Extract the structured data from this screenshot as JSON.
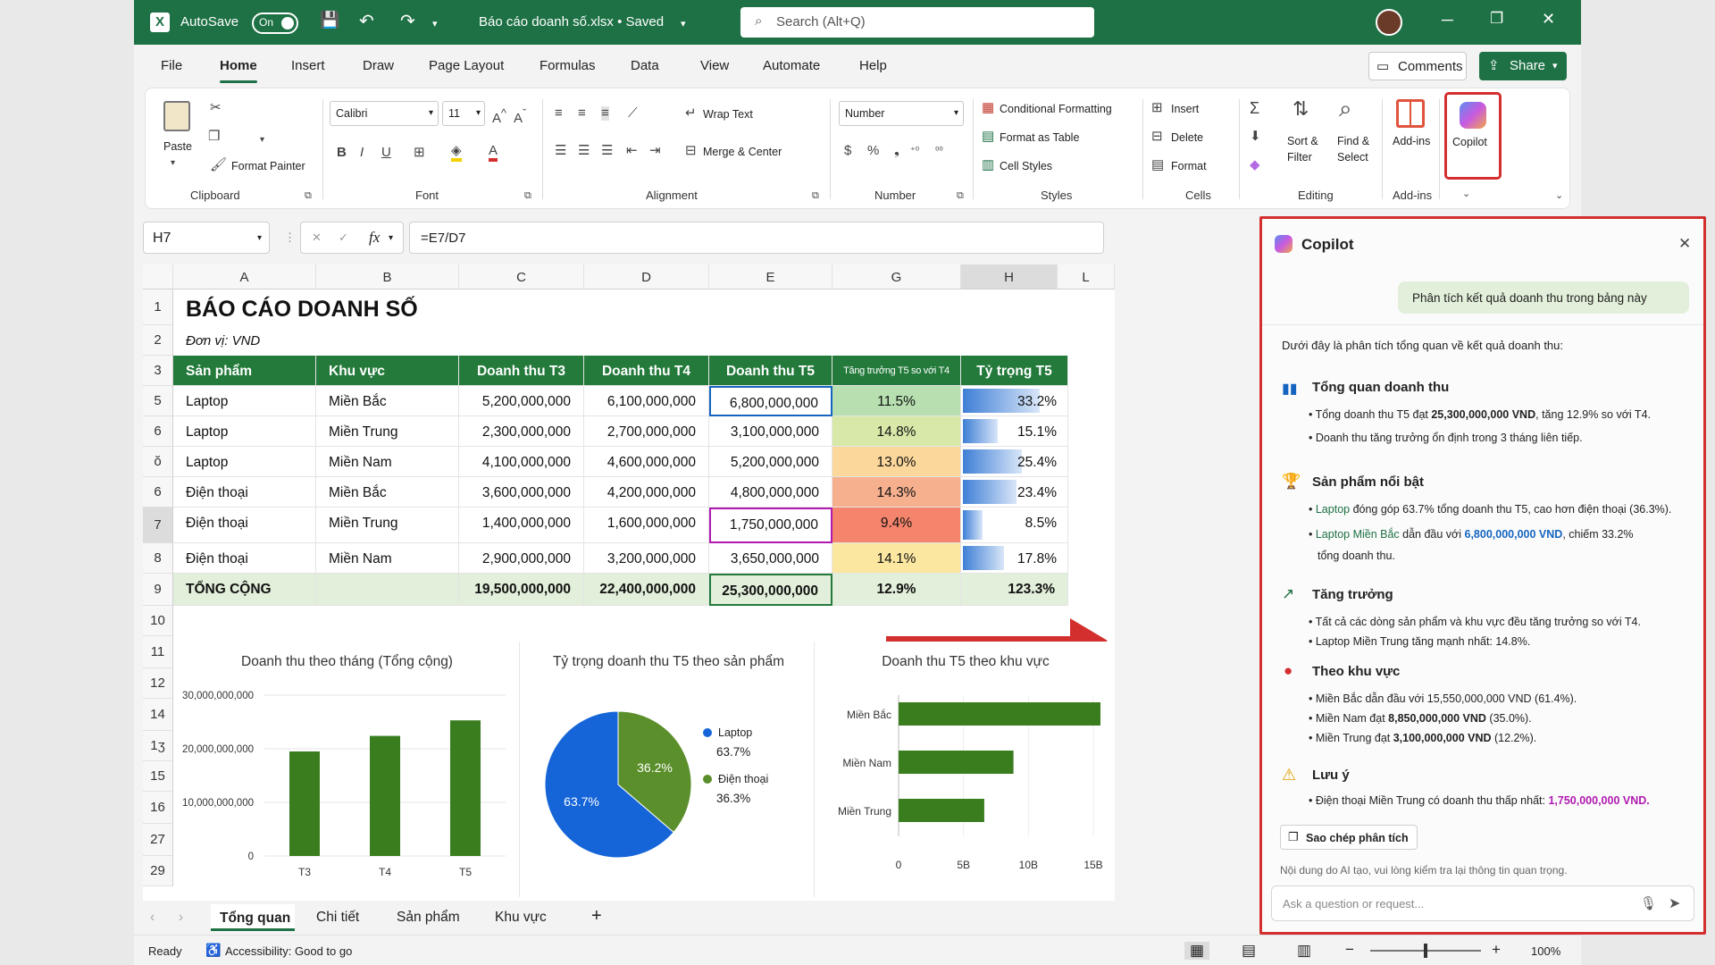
{
  "titlebar": {
    "autosave": "AutoSave",
    "toggle": "On",
    "filename": "Báo cáo doanh số.xlsx • Saved",
    "search_placeholder": "Search (Alt+Q)"
  },
  "menu": {
    "tabs": [
      "File",
      "Home",
      "Insert",
      "Draw",
      "Page Layout",
      "Formulas",
      "Data",
      "View",
      "Automate",
      "Help"
    ],
    "comments": "Comments",
    "share": "Share"
  },
  "ribbon": {
    "clipboard": {
      "paste": "Paste",
      "format_painter": "Format Painter",
      "label": "Clipboard"
    },
    "font": {
      "name": "Calibri",
      "size": "11",
      "label": "Font"
    },
    "alignment": {
      "wrap": "Wrap Text",
      "merge": "Merge & Center",
      "label": "Alignment"
    },
    "number": {
      "format": "Number",
      "label": "Number"
    },
    "styles": {
      "cond": "Conditional Formatting",
      "table": "Format as Table",
      "cell": "Cell Styles",
      "label": "Styles"
    },
    "cells": {
      "insert": "Insert",
      "delete": "Delete",
      "format": "Format",
      "label": "Cells"
    },
    "editing": {
      "sort1": "Sort &",
      "sort2": "Filter",
      "find1": "Find &",
      "find2": "Select",
      "label": "Editing"
    },
    "addins": {
      "addins": "Add-ins",
      "label": "Add-ins"
    },
    "copilot": {
      "label": "Copilot"
    }
  },
  "formula_bar": {
    "cell_ref": "H7",
    "formula": "=E7/D7"
  },
  "sheet": {
    "columns": [
      "A",
      "B",
      "C",
      "D",
      "E",
      "G",
      "H",
      "L"
    ],
    "row_numbers": [
      "1",
      "2",
      "3",
      "5",
      "6",
      "ŏ",
      "6",
      "7",
      "8",
      "9",
      "10",
      "11",
      "12",
      "14",
      "1ʒ",
      "15",
      "16",
      "27",
      "29"
    ],
    "title": "BÁO CÁO DOANH SỐ",
    "unit": "Đơn vị: VND",
    "headers": [
      "Sản phẩm",
      "Khu vực",
      "Doanh thu T3",
      "Doanh thu T4",
      "Doanh thu T5",
      "Tăng trưởng T5 so với T4",
      "Tỷ trọng T5"
    ],
    "rows": [
      {
        "product": "Laptop",
        "region": "Miền Bắc",
        "t3": "5,200,000,000",
        "t4": "6,100,000,000",
        "t5": "6,800,000,000",
        "growth": "11.5%",
        "share": "33.2%",
        "share_val": 33.2,
        "gcolor": "#b7dfb0"
      },
      {
        "product": "Laptop",
        "region": "Miền Trung",
        "t3": "2,300,000,000",
        "t4": "2,700,000,000",
        "t5": "3,100,000,000",
        "growth": "14.8%",
        "share": "15.1%",
        "share_val": 15.1,
        "gcolor": "#d7e8a8"
      },
      {
        "product": "Laptop",
        "region": "Miền Nam",
        "t3": "4,100,000,000",
        "t4": "4,600,000,000",
        "t5": "5,200,000,000",
        "growth": "13.0%",
        "share": "25.4%",
        "share_val": 25.4,
        "gcolor": "#fcd79b"
      },
      {
        "product": "Điện thoại",
        "region": "Miền Bắc",
        "t3": "3,600,000,000",
        "t4": "4,200,000,000",
        "t5": "4,800,000,000",
        "growth": "14.3%",
        "share": "23.4%",
        "share_val": 23.4,
        "gcolor": "#f7b08e"
      },
      {
        "product": "Điện thoại",
        "region": "Miền Trung",
        "t3": "1,400,000,000",
        "t4": "1,600,000,000",
        "t5": "1,750,000,000",
        "growth": "9.4%",
        "share": "8.5%",
        "share_val": 8.5,
        "gcolor": "#f4846b"
      },
      {
        "product": "Điện thoại",
        "region": "Miền Nam",
        "t3": "2,900,000,000",
        "t4": "3,200,000,000",
        "t5": "3,650,000,000",
        "growth": "14.1%",
        "share": "17.8%",
        "share_val": 17.8,
        "gcolor": "#fbe7a0"
      }
    ],
    "total": {
      "label": "TỔNG CỘNG",
      "t3": "19,500,000,000",
      "t4": "22,400,000,000",
      "t5": "25,300,000,000",
      "growth": "12.9%",
      "share": "123.3%"
    }
  },
  "colors": {
    "excel_green": "#1e7145",
    "header_green": "#237a3b",
    "chart_green": "#3a7d1f",
    "pie_blue": "#1565d8",
    "pie_green": "#5b8f2b",
    "copilot_border": "#d32f2f",
    "accent_blue": "#1565c0",
    "accent_purple": "#b01ab0"
  },
  "chart_data": [
    {
      "type": "bar",
      "title": "Doanh thu theo tháng (Tổng cộng)",
      "categories": [
        "T3",
        "T4",
        "T5"
      ],
      "values": [
        19500000000,
        22400000000,
        25300000000
      ],
      "ylim": [
        0,
        30000000000
      ],
      "yticks": [
        "30,000,000,000",
        "20,000,000,000",
        "10,000,000,000",
        "0"
      ]
    },
    {
      "type": "pie",
      "title": "Tỷ trọng doanh thu T5 theo sản phẩm",
      "slices": [
        {
          "name": "Laptop",
          "value": 63.7,
          "label": "63.7%"
        },
        {
          "name": "Điện thoại",
          "value": 36.3,
          "label": "36.3%"
        }
      ],
      "inner_labels": [
        "63.7%",
        "36.2%"
      ]
    },
    {
      "type": "bar",
      "orientation": "horizontal",
      "title": "Doanh thu T5 theo khu vực",
      "categories": [
        "Miền Bắc",
        "Miền Nam",
        "Miền Trung"
      ],
      "values": [
        15550000000,
        8850000000,
        6600000000
      ],
      "xlim": [
        0,
        15000000000
      ],
      "xticks": [
        "0",
        "5B",
        "10B",
        "15B"
      ]
    }
  ],
  "copilot": {
    "title": "Copilot",
    "user_msg": "Phân tích kết quả doanh thu trong bảng này",
    "intro": "Dưới đây là phân tích tổng quan về kết quả doanh thu:",
    "s1_title": "Tổng quan doanh thu",
    "s1_b1_a": "Tổng doanh thu T5 đạt ",
    "s1_b1_b": "25,300,000,000 VND",
    "s1_b1_c": ", tăng 12.9% so với T4.",
    "s1_b2": "Doanh thu tăng trưởng ổn định trong 3 tháng liên tiếp.",
    "s2_title": "Sản phẩm nổi bật",
    "s2_b1_a": "Laptop",
    "s2_b1_b": " đóng góp 63.7% tổng doanh thu T5, cao hơn điện thoại (36.3%).",
    "s2_b2_a": "Laptop Miền Bắc",
    "s2_b2_b": " dẫn đầu với ",
    "s2_b2_c": "6,800,000,000 VND",
    "s2_b2_d": ", chiếm 33.2%",
    "s2_b2_e": "tổng doanh thu.",
    "s3_title": "Tăng trưởng",
    "s3_b1": "Tất cả các dòng sản phẩm và khu vực đều tăng trưởng so với T4.",
    "s3_b2": "Laptop Miền Trung tăng mạnh nhất: 14.8%.",
    "s4_title": "Theo khu vực",
    "s4_b1_a": "Miền Bắc dẫn đầu với ",
    "s4_b1_b": "15,550,000,000 VND",
    "s4_b1_c": " (61.4%).",
    "s4_b2_a": "Miền Nam đạt ",
    "s4_b2_b": "8,850,000,000 VND",
    "s4_b2_c": " (35.0%).",
    "s4_b3_a": "Miền Trung đạt ",
    "s4_b3_b": "3,100,000,000 VND",
    "s4_b3_c": " (12.2%).",
    "s5_title": "Lưu ý",
    "s5_b1_a": "Điện thoại Miền Trung có doanh thu thấp nhất: ",
    "s5_b1_b": "1,750,000,000 VND.",
    "copy_btn": "Sao chép phân tích",
    "disclaimer": "Nội dung do AI tạo, vui lòng kiểm tra lại thông tin quan trọng.",
    "input_placeholder": "Ask a question or request..."
  },
  "sheet_tabs": [
    "Tổng quan",
    "Chi tiết",
    "Sản phẩm",
    "Khu vực"
  ],
  "status": {
    "ready": "Ready",
    "accessibility": "Accessibility: Good to go",
    "zoom": "100%",
    "zoom_level": 0.5
  }
}
